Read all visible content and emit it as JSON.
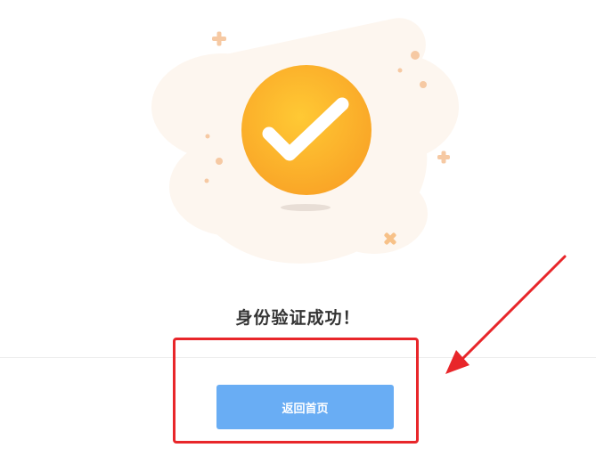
{
  "result": {
    "title": "身份验证成功！",
    "status_icon": "check-circle-icon"
  },
  "actions": {
    "home_button_label": "返回首页"
  },
  "annotation": {
    "highlight_color": "#e8262a",
    "arrow_color": "#e8262a"
  },
  "colors": {
    "badge_fill": "#fbb52c",
    "button_fill": "#69adf4",
    "sparkle_color": "#f6c9a3",
    "blob_color": "#fdf6ef"
  }
}
